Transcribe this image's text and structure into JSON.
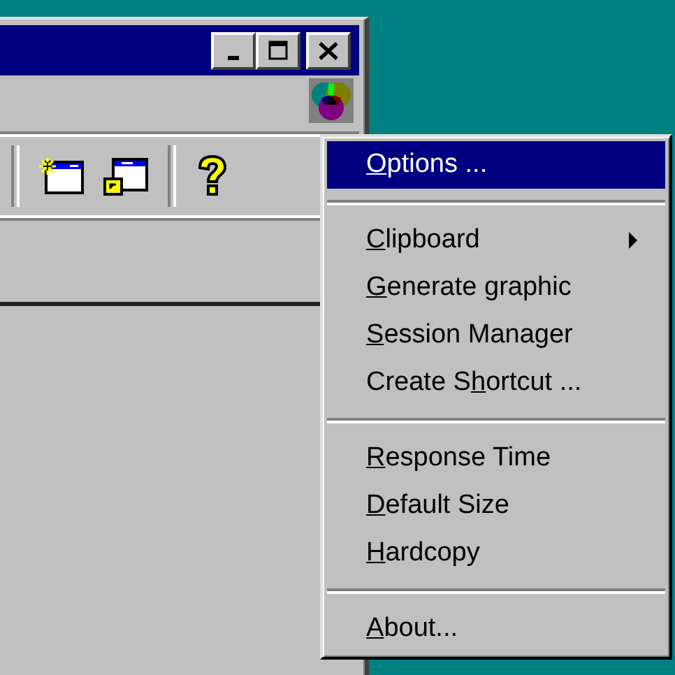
{
  "window": {
    "controls": [
      {
        "kind": "minimize"
      },
      {
        "kind": "maximize"
      },
      {
        "kind": "close"
      }
    ]
  },
  "toolbar": {
    "buttons": [
      {
        "kind": "new-window"
      },
      {
        "kind": "linked-window"
      },
      {
        "kind": "separator"
      },
      {
        "kind": "help"
      }
    ]
  },
  "menu": {
    "items": [
      {
        "kind": "item",
        "label": {
          "key": "O",
          "after": "ptions ..."
        },
        "selected": true,
        "submenu": false
      },
      {
        "kind": "separator"
      },
      {
        "kind": "item",
        "label": {
          "key": "C",
          "after": "lipboard"
        },
        "selected": false,
        "submenu": true
      },
      {
        "kind": "item",
        "label": {
          "key": "G",
          "after": "enerate graphic"
        },
        "selected": false,
        "submenu": false
      },
      {
        "kind": "item",
        "label": {
          "key": "S",
          "after": "ession Manager"
        },
        "selected": false,
        "submenu": false
      },
      {
        "kind": "item",
        "label": {
          "before": "Create S",
          "key": "h",
          "after": "ortcut ..."
        },
        "selected": false,
        "submenu": false
      },
      {
        "kind": "separator"
      },
      {
        "kind": "item",
        "label": {
          "key": "R",
          "after": "esponse Time"
        },
        "selected": false,
        "submenu": false
      },
      {
        "kind": "item",
        "label": {
          "key": "D",
          "after": "efault Size"
        },
        "selected": false,
        "submenu": false
      },
      {
        "kind": "item",
        "label": {
          "key": "H",
          "after": "ardcopy"
        },
        "selected": false,
        "submenu": false
      },
      {
        "kind": "separator"
      },
      {
        "kind": "item",
        "label": {
          "key": "A",
          "after": "bout..."
        },
        "selected": false,
        "submenu": false
      }
    ]
  }
}
